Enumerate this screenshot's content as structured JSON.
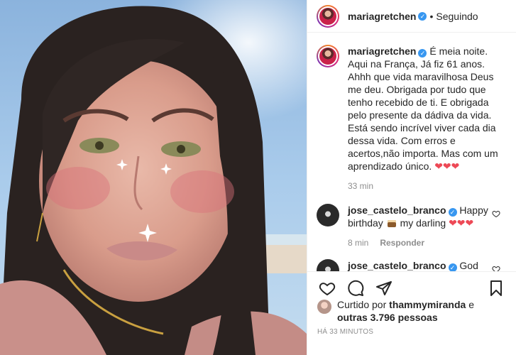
{
  "post": {
    "author": "mariagretchen",
    "follow_status": "Seguindo",
    "separator": "•",
    "caption": "É meia noite. Aqui na França, Já fiz 61 anos. Ahhh que vida maravilhosa Deus me deu. Obrigada por tudo que tenho recebido de ti. E obrigada pelo presente da dádiva da vida. Está sendo incrível viver cada dia dessa vida. Com erros e acertos,não importa. Mas com um aprendizado único.",
    "caption_hearts": "❤❤❤",
    "caption_time": "33 min"
  },
  "comments": [
    {
      "user": "jose_castelo_branco",
      "text_before": "Happy birthday",
      "text_after": "my darling",
      "hearts": "❤❤❤",
      "time": "8 min",
      "reply_label": "Responder"
    },
    {
      "user": "jose_castelo_branco",
      "text": "God Bless"
    }
  ],
  "likes": {
    "prefix": "Curtido por",
    "user": "thammymiranda",
    "conj": "e",
    "others": "outras 3.796 pessoas"
  },
  "post_time": "HÁ 33 MINUTOS",
  "icons": {
    "like": "heart-outline-icon",
    "comment": "comment-bubble-icon",
    "share": "paper-plane-icon",
    "save": "bookmark-icon",
    "verified": "verified-badge-icon"
  },
  "colors": {
    "verified": "#3897f0",
    "heart": "#ed4956",
    "muted": "#8e8e8e",
    "text": "#262626"
  }
}
